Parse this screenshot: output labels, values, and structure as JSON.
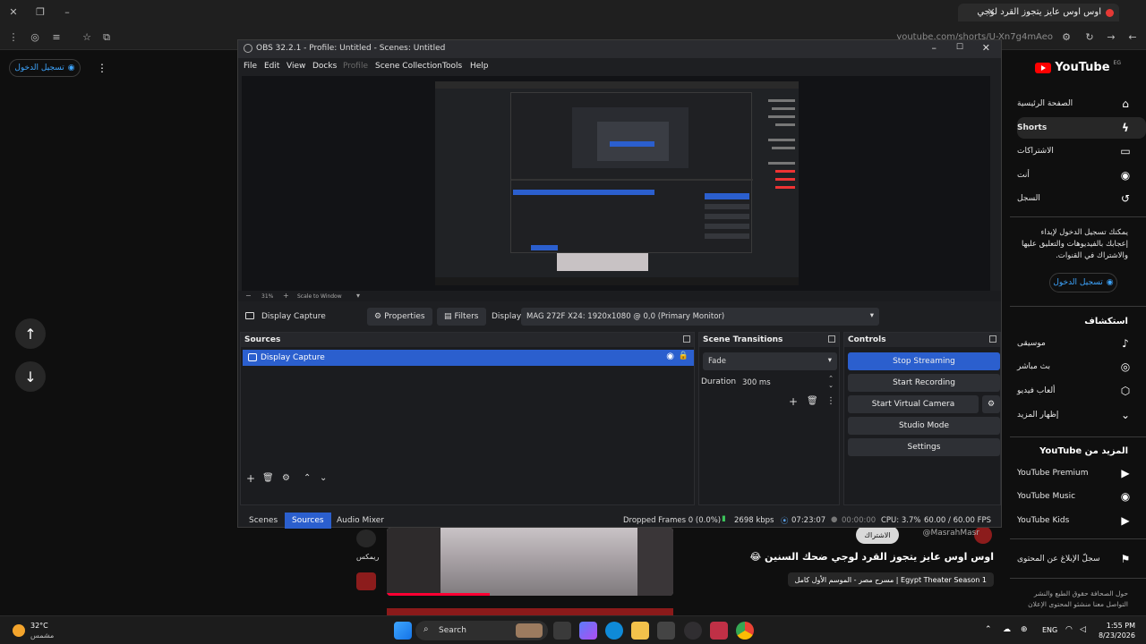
{
  "browser": {
    "tab_title": "اوس اوس عايز يتجوز القرد لوجي",
    "url": "youtube.com/shorts/U-Xn7g4mAeo"
  },
  "youtube": {
    "logo": "YouTube",
    "logo_region": "EG",
    "signin_label": "تسجيل الدخول",
    "nav": [
      {
        "label": "الصفحة الرئيسية",
        "icon": "home-icon"
      },
      {
        "label": "Shorts",
        "icon": "shorts-icon"
      },
      {
        "label": "الاشتراكات",
        "icon": "subscriptions-icon"
      },
      {
        "label": "أنت",
        "icon": "you-icon"
      },
      {
        "label": "السجل",
        "icon": "history-icon"
      }
    ],
    "signin_prompt": "يمكنك تسجيل الدخول لإبداء إعجابك بالفيديوهات والتعليق عليها والاشتراك في القنوات.",
    "explore_title": "استكشاف",
    "explore": [
      {
        "label": "موسيقى",
        "icon": "music-icon"
      },
      {
        "label": "بث مباشر",
        "icon": "live-icon"
      },
      {
        "label": "ألعاب فيديو",
        "icon": "gaming-icon"
      },
      {
        "label": "إظهار المزيد",
        "icon": "chevron-down-icon"
      }
    ],
    "more_title": "المزيد من YouTube",
    "more": [
      {
        "label": "YouTube Premium"
      },
      {
        "label": "YouTube Music"
      },
      {
        "label": "YouTube Kids"
      }
    ],
    "report": "سجلّ الإبلاغ عن المحتوى",
    "footer": "حول الصحافة حقوق الطبع والنشر التواصل معنا منشئو المحتوى الإعلان",
    "video_title": "اوس اوس عايز يتجوز القرد لوجي ضحك السنين 😂",
    "channel": "@MasrahMasr",
    "subscribe": "الاشتراك",
    "playlist": "مسرح مصر - الموسم الأول كامل | Egypt Theater Season 1",
    "remix": "ريمكس"
  },
  "obs": {
    "title": "OBS 32.2.1 - Profile: Untitled - Scenes: Untitled",
    "menus": [
      "File",
      "Edit",
      "View",
      "Docks",
      "Profile",
      "Scene Collection",
      "Tools",
      "Help"
    ],
    "zoom": "31%",
    "scale_label": "Scale to Window",
    "source_name": "Display Capture",
    "properties": "Properties",
    "filters": "Filters",
    "display_label": "Display",
    "display_value": "MAG 272F X24: 1920x1080 @ 0,0 (Primary Monitor)",
    "sources_title": "Sources",
    "sources": [
      "Display Capture"
    ],
    "transitions_title": "Scene Transitions",
    "transition": "Fade",
    "duration_label": "Duration",
    "duration_value": "300 ms",
    "controls_title": "Controls",
    "controls": {
      "stream": "Stop Streaming",
      "record": "Start Recording",
      "virtualcam": "Start Virtual Camera",
      "studio": "Studio Mode",
      "settings": "Settings"
    },
    "tabs": [
      "Scenes",
      "Sources",
      "Audio Mixer"
    ],
    "status": {
      "dropped": "Dropped Frames 0 (0.0%)",
      "bitrate": "2698 kbps",
      "stream_time": "07:23:07",
      "rec_time": "00:00:00",
      "cpu": "CPU: 3.7%",
      "fps": "60.00 / 60.00 FPS"
    }
  },
  "taskbar": {
    "weather_temp": "32°C",
    "weather_desc": "مشمس",
    "search": "Search",
    "lang": "ENG",
    "time": "1:55 PM",
    "date": "8/23/2026"
  }
}
